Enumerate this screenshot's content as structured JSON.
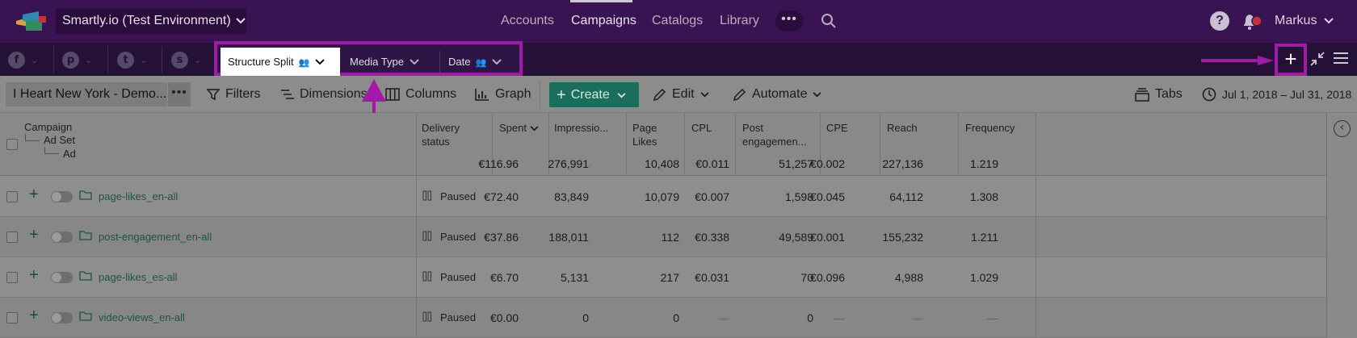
{
  "topnav": {
    "environment": "Smartly.io (Test Environment)",
    "links": [
      "Accounts",
      "Campaigns",
      "Catalogs",
      "Library"
    ],
    "active_link": "Campaigns",
    "more_label": "•••",
    "help_label": "?",
    "user_name": "Markus"
  },
  "tabbar": {
    "platforms": [
      "facebook",
      "pinterest",
      "twitter",
      "snapchat"
    ],
    "platform_glyphs": [
      "f",
      "p",
      "t",
      "s"
    ],
    "views": [
      {
        "label": "Structure Split",
        "active": true,
        "shared": true
      },
      {
        "label": "Media Type",
        "active": false,
        "shared": false
      },
      {
        "label": "Date",
        "active": false,
        "shared": true
      }
    ],
    "add_label": "+"
  },
  "toolbar": {
    "breadcrumb": "I Heart New York - Demo...",
    "more_label": "•••",
    "filters": "Filters",
    "dimensions": "Dimensions",
    "columns": "Columns",
    "graph": "Graph",
    "create": "Create",
    "edit": "Edit",
    "automate": "Automate",
    "tabs": "Tabs",
    "date_range": "Jul 1, 2018 – Jul 31, 2018"
  },
  "table": {
    "hierarchy": [
      "Campaign",
      "Ad Set",
      "Ad"
    ],
    "columns": [
      {
        "key": "status",
        "label": [
          "Delivery",
          "status"
        ],
        "total": ""
      },
      {
        "key": "spent",
        "label": [
          "Spent"
        ],
        "total": "€116.96",
        "sorted": true
      },
      {
        "key": "impressions",
        "label": [
          "Impressio..."
        ],
        "total": "276,991"
      },
      {
        "key": "page_likes",
        "label": [
          "Page",
          "Likes"
        ],
        "total": "10,408"
      },
      {
        "key": "cpl",
        "label": [
          "CPL"
        ],
        "total": "€0.011"
      },
      {
        "key": "post_engagement",
        "label": [
          "Post",
          "engagemen..."
        ],
        "total": "51,257"
      },
      {
        "key": "cpe",
        "label": [
          "CPE"
        ],
        "total": "€0.002"
      },
      {
        "key": "reach",
        "label": [
          "Reach"
        ],
        "total": "227,136"
      },
      {
        "key": "frequency",
        "label": [
          "Frequency"
        ],
        "total": "1.219"
      }
    ],
    "rows": [
      {
        "name": "page-likes_en-all",
        "status": "Paused",
        "spent": "€72.40",
        "impressions": "83,849",
        "page_likes": "10,079",
        "cpl": "€0.007",
        "post_engagement": "1,598",
        "cpe": "€0.045",
        "reach": "64,112",
        "frequency": "1.308"
      },
      {
        "name": "post-engagement_en-all",
        "status": "Paused",
        "spent": "€37.86",
        "impressions": "188,011",
        "page_likes": "112",
        "cpl": "€0.338",
        "post_engagement": "49,589",
        "cpe": "€0.001",
        "reach": "155,232",
        "frequency": "1.211"
      },
      {
        "name": "page-likes_es-all",
        "status": "Paused",
        "spent": "€6.70",
        "impressions": "5,131",
        "page_likes": "217",
        "cpl": "€0.031",
        "post_engagement": "70",
        "cpe": "€0.096",
        "reach": "4,988",
        "frequency": "1.029"
      },
      {
        "name": "video-views_en-all",
        "status": "Paused",
        "spent": "€0.00",
        "impressions": "0",
        "page_likes": "0",
        "cpl": "—",
        "post_engagement": "0",
        "cpe": "—",
        "reach": "—",
        "frequency": "—"
      }
    ],
    "row_plus": "+"
  },
  "right_panel": {
    "toggle_glyph": "‹"
  },
  "colors": {
    "nav_bg": "#3a1452",
    "tabbar_bg": "#251038",
    "highlight": "#a11aa8",
    "create_bg": "#1b6f5a",
    "link_green": "#1a5548"
  }
}
